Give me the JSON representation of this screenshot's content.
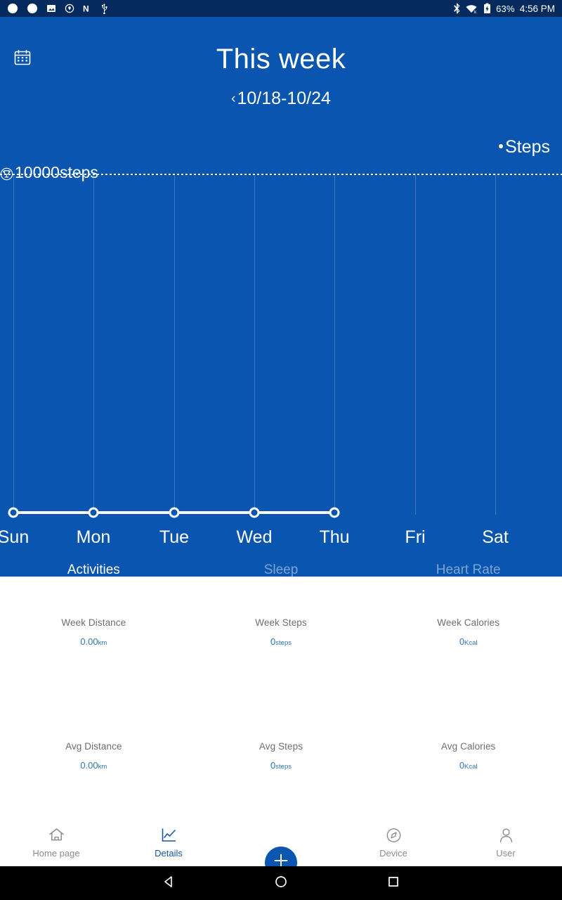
{
  "statusbar": {
    "left_icons": [
      "app-sync-icon",
      "app-sync-alt-icon",
      "photo-icon",
      "shield-location-icon",
      "letter-n-icon",
      "usb-icon"
    ],
    "bluetooth_icon": "bluetooth-icon",
    "wifi_icon": "wifi-disconnected-icon",
    "battery_icon": "battery-charging-icon",
    "battery_percent": "63%",
    "time": "4:56 PM"
  },
  "header": {
    "calendar_icon": "calendar-icon",
    "title": "This week",
    "prev_arrow": "‹",
    "date_range": "10/18-10/24"
  },
  "colors": {
    "panel_blue": "#0a55af",
    "statusbar_blue": "#062a5e",
    "accent_blue": "#3074b4",
    "fab_blue": "#0b56b0",
    "white": "#ffffff"
  },
  "chart_data": {
    "type": "line",
    "title": "This week",
    "legend": [
      {
        "name": "Steps",
        "color": "#ffffff"
      }
    ],
    "legend_position": "top-right",
    "goal_label": "10000steps",
    "goal_icon": "trophy-icon",
    "goal_value": 10000,
    "categories": [
      "Sun",
      "Mon",
      "Tue",
      "Wed",
      "Thu",
      "Fri",
      "Sat"
    ],
    "series": [
      {
        "name": "Steps",
        "values": [
          0,
          0,
          0,
          0,
          0,
          null,
          null
        ]
      }
    ],
    "ylim": [
      0,
      10000
    ],
    "xlabel": "",
    "ylabel": "",
    "grid": true,
    "grid_style": "vertical-solid, horizontal-goal-dotted"
  },
  "tabs": [
    {
      "label": "Activities",
      "active": true
    },
    {
      "label": "Sleep",
      "active": false
    },
    {
      "label": "Heart Rate",
      "active": false
    }
  ],
  "stats": {
    "row1": [
      {
        "label": "Week Distance",
        "value": "0.00",
        "unit": "km"
      },
      {
        "label": "Week Steps",
        "value": "0",
        "unit": "steps"
      },
      {
        "label": "Week Calories",
        "value": "0",
        "unit": "Kcal"
      }
    ],
    "row2": [
      {
        "label": "Avg Distance",
        "value": "0.00",
        "unit": "km"
      },
      {
        "label": "Avg Steps",
        "value": "0",
        "unit": "steps"
      },
      {
        "label": "Avg Calories",
        "value": "0",
        "unit": "Kcal"
      }
    ]
  },
  "bottomnav": [
    {
      "label": "Home page",
      "icon": "home-icon",
      "active": false
    },
    {
      "label": "Details",
      "icon": "chart-icon",
      "active": true
    },
    {
      "label": "",
      "icon": "plus-icon",
      "active": false
    },
    {
      "label": "Device",
      "icon": "compass-icon",
      "active": false
    },
    {
      "label": "User",
      "icon": "person-icon",
      "active": false
    }
  ],
  "androidnav": {
    "back": "back-triangle-icon",
    "home": "home-circle-icon",
    "recents": "recents-square-icon"
  }
}
